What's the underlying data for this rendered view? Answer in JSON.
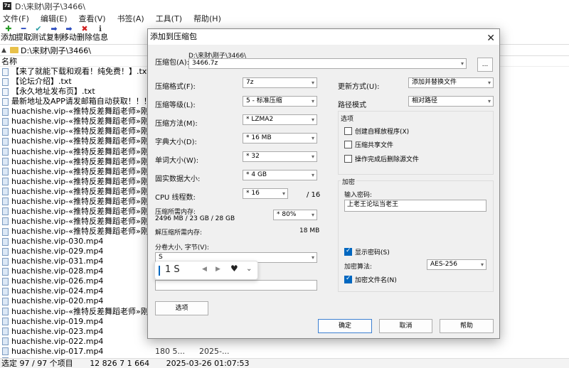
{
  "window": {
    "title": "D:\\来财\\刚子\\3466\\"
  },
  "menu": [
    "文件(F)",
    "编辑(E)",
    "查看(V)",
    "书签(A)",
    "工具(T)",
    "帮助(H)"
  ],
  "toolbar": [
    {
      "label": "添加",
      "icon": "plus-icon",
      "glyph": "✚",
      "color": "#2a9d2a"
    },
    {
      "label": "提取",
      "icon": "minus-icon",
      "glyph": "━",
      "color": "#2b4bbf"
    },
    {
      "label": "测试",
      "icon": "check-icon",
      "glyph": "✔",
      "color": "#2a9da4"
    },
    {
      "label": "复制",
      "icon": "copy-arrow-icon",
      "glyph": "➡",
      "color": "#2b4bbf"
    },
    {
      "label": "移动",
      "icon": "move-arrow-icon",
      "glyph": "➡",
      "color": "#2b4bbf"
    },
    {
      "label": "删除",
      "icon": "delete-x-icon",
      "glyph": "✖",
      "color": "#d02020"
    },
    {
      "label": "信息",
      "icon": "info-icon",
      "glyph": "ℹ",
      "color": "#444444"
    }
  ],
  "address": "D:\\来财\\刚子\\3466\\",
  "list_header": {
    "name": "名称"
  },
  "files": [
    {
      "name": "【来了就能下载和观看！纯免费！】.txt",
      "size": "",
      "date": ""
    },
    {
      "name": "【论坛介绍】.txt",
      "size": "",
      "date": ""
    },
    {
      "name": "【永久地址发布页】.txt",
      "size": "",
      "date": ""
    },
    {
      "name": "最新地址及APP请发邮箱自动获取！！！.txt",
      "size": "",
      "date": ""
    },
    {
      "name": "huachishe.vip-«推特反差舞蹈老师»刚子 52...",
      "size": "",
      "date": ""
    },
    {
      "name": "huachishe.vip-«推特反差舞蹈老师»刚子 52...",
      "size": "",
      "date": ""
    },
    {
      "name": "huachishe.vip-«推特反差舞蹈老师»刚子 52...",
      "size": "",
      "date": ""
    },
    {
      "name": "huachishe.vip-«推特反差舞蹈老师»刚子 52...",
      "size": "",
      "date": ""
    },
    {
      "name": "huachishe.vip-«推特反差舞蹈老师»刚子 52...",
      "size": "",
      "date": ""
    },
    {
      "name": "huachishe.vip-«推特反差舞蹈老师»刚子 52...",
      "size": "",
      "date": ""
    },
    {
      "name": "huachishe.vip-«推特反差舞蹈老师»刚子 52...",
      "size": "",
      "date": ""
    },
    {
      "name": "huachishe.vip-«推特反差舞蹈老师»刚子 52...",
      "size": "",
      "date": ""
    },
    {
      "name": "huachishe.vip-«推特反差舞蹈老师»刚子 52...",
      "size": "",
      "date": ""
    },
    {
      "name": "huachishe.vip-«推特反差舞蹈老师»刚子 52...",
      "size": "",
      "date": ""
    },
    {
      "name": "huachishe.vip-«推特反差舞蹈老师»刚子 52...",
      "size": "",
      "date": ""
    },
    {
      "name": "huachishe.vip-«推特反差舞蹈老师»刚子 52...",
      "size": "",
      "date": ""
    },
    {
      "name": "huachishe.vip-«推特反差舞蹈老师»刚子 52...",
      "size": "",
      "date": ""
    },
    {
      "name": "huachishe.vip-030.mp4",
      "size": "",
      "date": ""
    },
    {
      "name": "huachishe.vip-029.mp4",
      "size": "",
      "date": ""
    },
    {
      "name": "huachishe.vip-031.mp4",
      "size": "",
      "date": ""
    },
    {
      "name": "huachishe.vip-028.mp4",
      "size": "",
      "date": ""
    },
    {
      "name": "huachishe.vip-026.mp4",
      "size": "",
      "date": ""
    },
    {
      "name": "huachishe.vip-024.mp4",
      "size": "",
      "date": ""
    },
    {
      "name": "huachishe.vip-020.mp4",
      "size": "",
      "date": ""
    },
    {
      "name": "huachishe.vip-«推特反差舞蹈老师»刚子 52...",
      "size": "",
      "date": ""
    },
    {
      "name": "huachishe.vip-019.mp4",
      "size": "",
      "date": ""
    },
    {
      "name": "huachishe.vip-023.mp4",
      "size": "",
      "date": ""
    },
    {
      "name": "huachishe.vip-022.mp4",
      "size": "",
      "date": ""
    },
    {
      "name": "huachishe.vip-017.mp4",
      "size": "180 5...",
      "date": "2025-..."
    },
    {
      "name": "huachishe.vip-016.mp4",
      "size": "",
      "date": ""
    }
  ],
  "status": {
    "selection": "选定 97 / 97 个项目",
    "size": "12 826 7 1 664",
    "datetime": "2025-03-26 01:07:53"
  },
  "dialog": {
    "title": "添加到压缩包",
    "archive_label": "压缩包(A):",
    "archive_path": "D:\\来财\\刚子\\3466\\",
    "archive_name": "3466.7z",
    "browse_label": "...",
    "format_label": "压缩格式(F):",
    "format_value": "7z",
    "level_label": "压缩等级(L):",
    "level_value": "5 - 标准压缩",
    "method_label": "压缩方法(M):",
    "method_value": "*  LZMA2",
    "dict_label": "字典大小(D):",
    "dict_value": "*  16 MB",
    "word_label": "单词大小(W):",
    "word_value": "*  32",
    "solid_label": "固实数据大小:",
    "solid_value": "*  4 GB",
    "threads_label": "CPU 线程数:",
    "threads_value": "*  16",
    "threads_total": "/ 16",
    "mem_label": "压缩所需内存:",
    "mem_value": "2496 MB / 23 GB / 28 GB",
    "mem_percent": "* 80%",
    "decomp_label": "解压缩所需内存:",
    "decomp_value": "18 MB",
    "split_label": "分卷大小, 字节(V):",
    "split_value": "S",
    "options_button": "选项",
    "update_label": "更新方式(U):",
    "update_value": "添加并替换文件",
    "path_label": "路径模式",
    "path_value": "相对路径",
    "options_group": "选项",
    "opt_sfx": "创建自释放程序(X)",
    "opt_shared": "压缩共享文件",
    "opt_delete": "操作完成后删除源文件",
    "encrypt_group": "加密",
    "password_label": "输入密码:",
    "password_value": "上老王论坛当老王",
    "show_password": "显示密码(S)",
    "enc_method_label": "加密算法:",
    "enc_method_value": "AES-256",
    "encrypt_names": "加密文件名(N)",
    "ok": "确定",
    "cancel": "取消",
    "help": "帮助"
  },
  "ime": {
    "candidate": "1 S"
  },
  "colors": {
    "accent": "#0067c0",
    "folder": "#e8c14a"
  }
}
